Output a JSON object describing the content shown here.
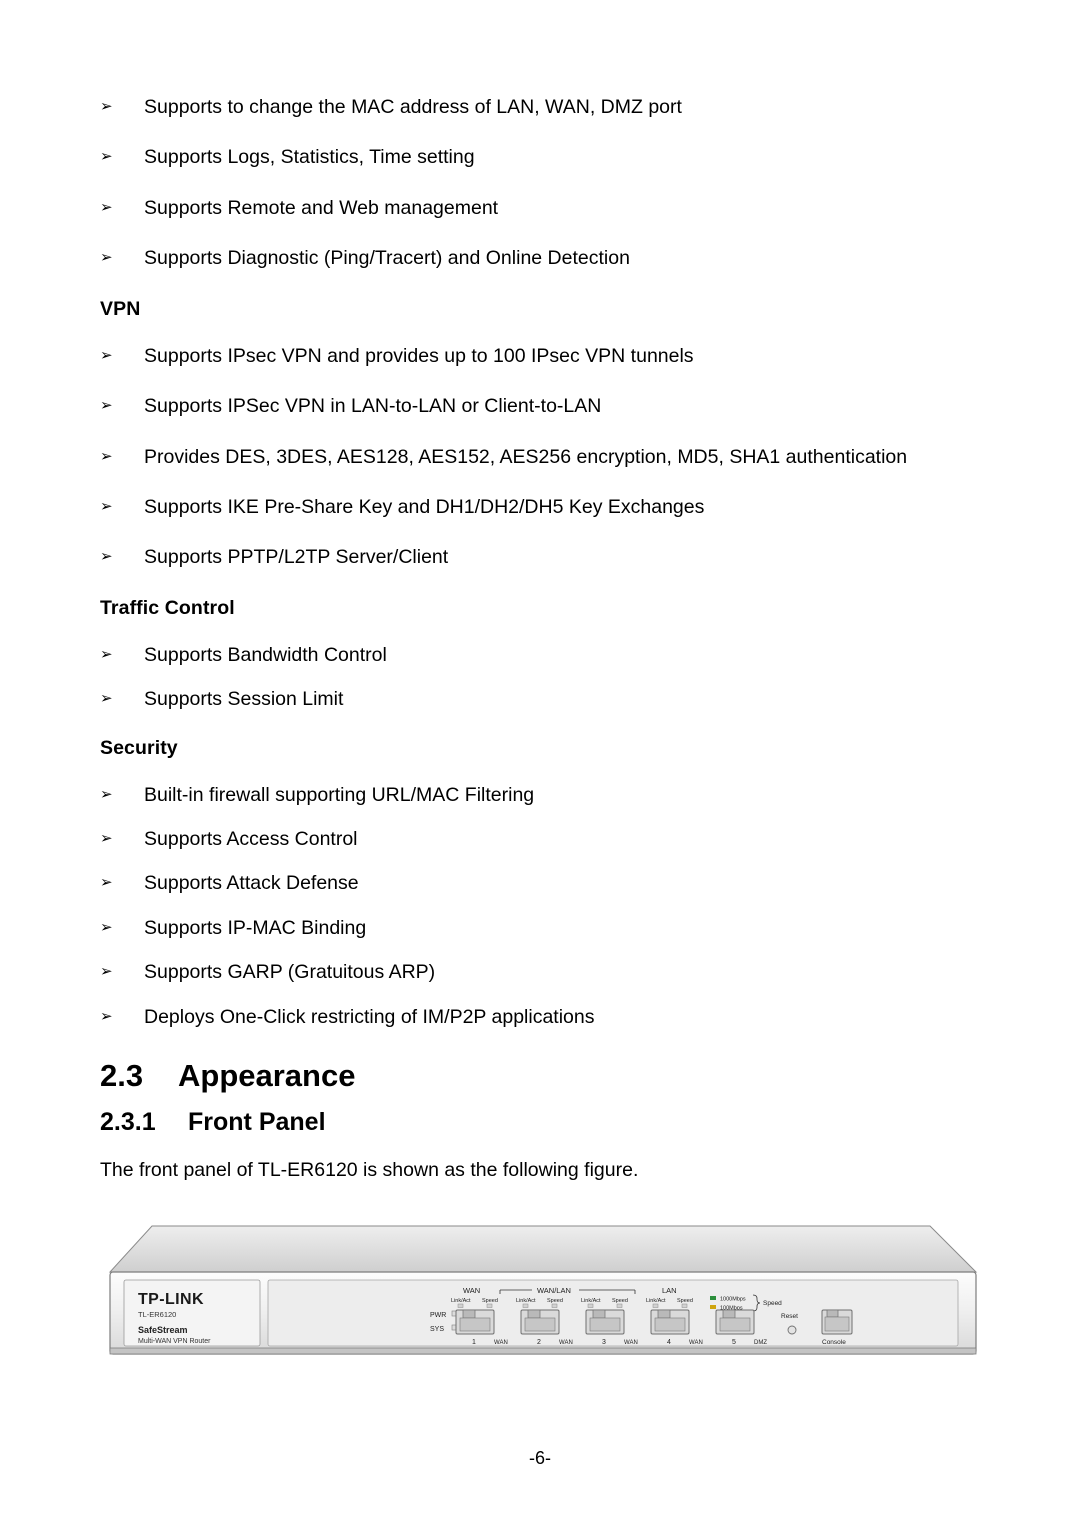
{
  "page": {
    "footer": "-6-"
  },
  "top_bullets": [
    "Supports to change the MAC address of LAN, WAN, DMZ port",
    "Supports Logs, Statistics, Time setting",
    "Supports Remote and Web management",
    "Supports Diagnostic (Ping/Tracert) and Online Detection"
  ],
  "sections": [
    {
      "heading": "VPN",
      "bullets": [
        "Supports IPsec VPN and provides up to 100 IPsec VPN tunnels",
        "Supports IPSec VPN in LAN-to-LAN or Client-to-LAN",
        "Provides DES, 3DES, AES128, AES152, AES256 encryption, MD5, SHA1 authentication",
        "Supports IKE Pre-Share Key and DH1/DH2/DH5 Key Exchanges",
        "Supports PPTP/L2TP Server/Client"
      ]
    },
    {
      "heading": "Traffic Control",
      "bullets": [
        "Supports Bandwidth Control",
        "Supports Session Limit"
      ]
    },
    {
      "heading": "Security",
      "bullets": [
        "Built-in firewall supporting URL/MAC Filtering",
        "Supports Access Control",
        "Supports Attack Defense",
        "Supports IP-MAC Binding",
        "Supports GARP (Gratuitous ARP)",
        "Deploys One-Click restricting of IM/P2P applications"
      ]
    }
  ],
  "bullet_glyph": "➢",
  "appearance": {
    "number": "2.3",
    "title": "Appearance",
    "sub_number": "2.3.1",
    "sub_title": "Front Panel",
    "paragraph": "The front panel of TL-ER6120 is shown as the following figure."
  },
  "device": {
    "brand": "TP-LINK",
    "model": "TL-ER6120",
    "series": "SafeStream",
    "tagline": "Multi-WAN VPN Router",
    "led_labels": [
      "PWR",
      "SYS"
    ],
    "group_labels": [
      "WAN",
      "WAN/LAN",
      "LAN"
    ],
    "legend": [
      {
        "text": "1000Mbps",
        "color": "#2c8f3c"
      },
      {
        "text": "100Mbps",
        "color": "#cfa50e"
      }
    ],
    "legend_title": "Speed",
    "port_led_left": "Link/Act",
    "port_led_right": "Speed",
    "ports": [
      {
        "number": "1",
        "label": "WAN"
      },
      {
        "number": "2",
        "label": "WAN"
      },
      {
        "number": "3",
        "label": "WAN"
      },
      {
        "number": "4",
        "label": "WAN"
      },
      {
        "number": "5",
        "label": "DMZ"
      }
    ],
    "reset_label": "Reset",
    "console_label": "Console"
  }
}
